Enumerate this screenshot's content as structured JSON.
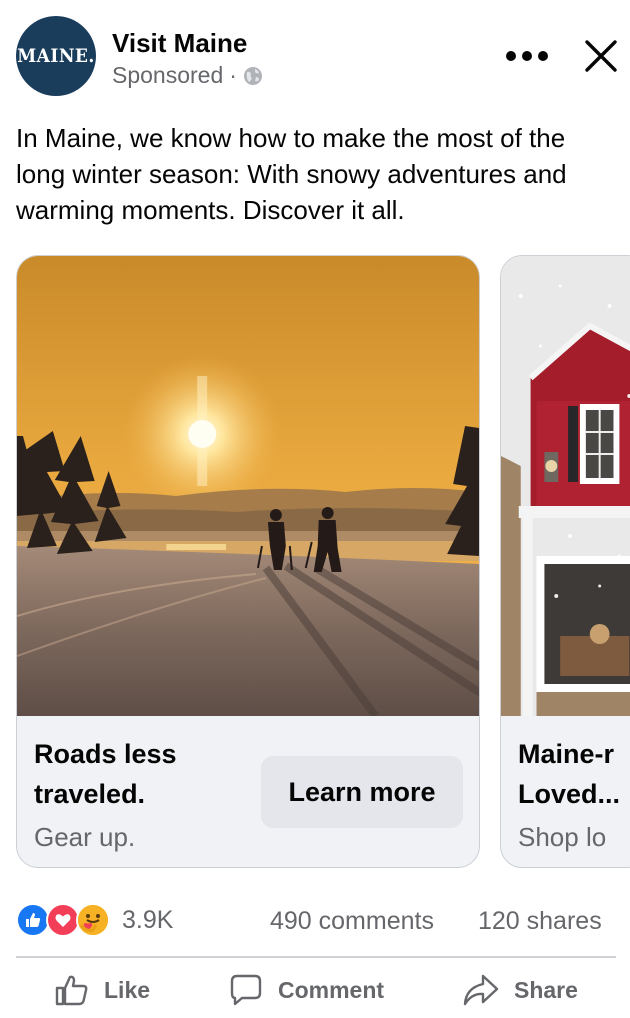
{
  "header": {
    "avatar_text": "MAINE.",
    "page_name": "Visit Maine",
    "sponsored": "Sponsored",
    "separator": "·"
  },
  "post": {
    "text": "In Maine, we know how to make the most of the long winter season: With snowy adventures and warming moments. Discover it all."
  },
  "carousel": {
    "cards": [
      {
        "image": "sunset-skiers-photo",
        "headline": "Roads less traveled.",
        "description": "Gear up.",
        "cta": "Learn more"
      },
      {
        "image": "red-house-snow-photo",
        "headline": "Maine-r\nLoved...",
        "description": "Shop lo"
      }
    ]
  },
  "engagement": {
    "reactions": [
      "like-reaction-icon",
      "love-reaction-icon",
      "care-reaction-icon"
    ],
    "reaction_count": "3.9K",
    "comments": "490 comments",
    "shares": "120 shares"
  },
  "actions": {
    "like": "Like",
    "comment": "Comment",
    "share": "Share"
  },
  "colors": {
    "like_blue": "#1877f2",
    "love_red": "#f33e58",
    "secondary_text": "#65676b",
    "card_bg": "#f0f2f5"
  }
}
